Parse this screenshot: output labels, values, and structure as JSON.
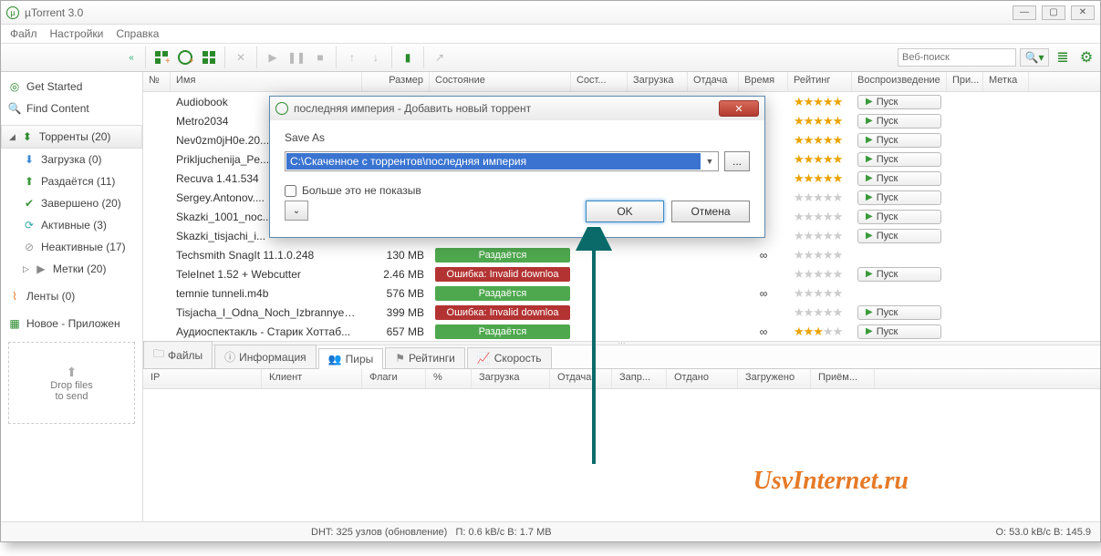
{
  "window": {
    "title": "µTorrent 3.0"
  },
  "menu": {
    "file": "Файл",
    "settings": "Настройки",
    "help": "Справка"
  },
  "search": {
    "placeholder": "Веб-поиск"
  },
  "sidebar": {
    "get_started": "Get Started",
    "find_content": "Find Content",
    "torrents": "Торренты (20)",
    "download": "Загрузка (0)",
    "seeding": "Раздаётся (11)",
    "completed": "Завершено (20)",
    "active": "Активные (3)",
    "inactive": "Неактивные (17)",
    "labels": "Метки (20)",
    "feeds": "Ленты (0)",
    "new_apps": "Новое - Приложен",
    "drop_title": "Drop files",
    "drop_sub": "to send"
  },
  "columns": {
    "no": "№",
    "name": "Имя",
    "size": "Размер",
    "state": "Состояние",
    "sost": "Сост...",
    "dl": "Загрузка",
    "ul": "Отдача",
    "time": "Время",
    "rating": "Рейтинг",
    "play": "Воспроизведение",
    "pri": "При...",
    "label": "Метка"
  },
  "torrents": [
    {
      "name": "Audiobook",
      "size": "",
      "state": "",
      "rating": 5,
      "play": true,
      "time": ""
    },
    {
      "name": "Metro2034",
      "size": "",
      "state": "",
      "rating": 5,
      "play": true,
      "time": ""
    },
    {
      "name": "Nev0zm0jH0e.20...",
      "size": "",
      "state": "",
      "rating": 5,
      "play": true,
      "time": ""
    },
    {
      "name": "Prikljuchenija_Pe...",
      "size": "",
      "state": "",
      "rating": 5,
      "play": true,
      "time": ""
    },
    {
      "name": "Recuva 1.41.534",
      "size": "",
      "state": "",
      "rating": 5,
      "play": true,
      "time": ""
    },
    {
      "name": "Sergey.Antonov....",
      "size": "",
      "state": "",
      "rating": 0,
      "play": true,
      "time": ""
    },
    {
      "name": "Skazki_1001_noc...",
      "size": "",
      "state": "",
      "rating": 0,
      "play": true,
      "time": ""
    },
    {
      "name": "Skazki_tisjachi_i...",
      "size": "",
      "state": "",
      "rating": 0,
      "play": true,
      "time": ""
    },
    {
      "name": "Techsmith SnagIt 11.1.0.248",
      "size": "130 MB",
      "state": "Раздаётся",
      "kind": "seed",
      "rating": 0,
      "time": "∞"
    },
    {
      "name": "TeleInet 1.52 + Webcutter",
      "size": "2.46 MB",
      "state": "Ошибка: Invalid downloa",
      "kind": "err",
      "rating": 0,
      "play": true,
      "time": ""
    },
    {
      "name": "temnie tunneli.m4b",
      "size": "576 MB",
      "state": "Раздаётся",
      "kind": "seed",
      "rating": 0,
      "time": "∞"
    },
    {
      "name": "Tisjacha_I_Odna_Noch_Izbrannye_...",
      "size": "399 MB",
      "state": "Ошибка: Invalid downloa",
      "kind": "err",
      "rating": 0,
      "play": true,
      "time": ""
    },
    {
      "name": "Аудиоспектакль - Старик Хоттаб...",
      "size": "657 MB",
      "state": "Раздаётся",
      "kind": "seed",
      "rating": 3,
      "play": true,
      "time": "∞"
    }
  ],
  "play_label": "Пуск",
  "tabs": {
    "files": "Файлы",
    "info": "Информация",
    "peers": "Пиры",
    "ratings": "Рейтинги",
    "speed": "Скорость"
  },
  "peer_cols": {
    "ip": "IP",
    "client": "Клиент",
    "flags": "Флаги",
    "pct": "%",
    "dl": "Загрузка",
    "ul": "Отдача",
    "req": "Запр...",
    "sent": "Отдано",
    "recv": "Загружено",
    "rx": "Приём..."
  },
  "statusbar": {
    "dht": "DHT: 325 узлов  (обновление)",
    "speed": "П: 0.6 kB/с В: 1.7 MB",
    "right": "О: 53.0 kB/с В: 145.9"
  },
  "dialog": {
    "title": "последняя империя - Добавить новый торрент",
    "save_as": "Save As",
    "path": "C:\\Скаченное с торрентов\\последняя империя",
    "browse": "...",
    "dont_show": "Больше это не показыв",
    "ok": "OK",
    "cancel": "Отмена"
  },
  "watermark": "UsvInternet.ru"
}
